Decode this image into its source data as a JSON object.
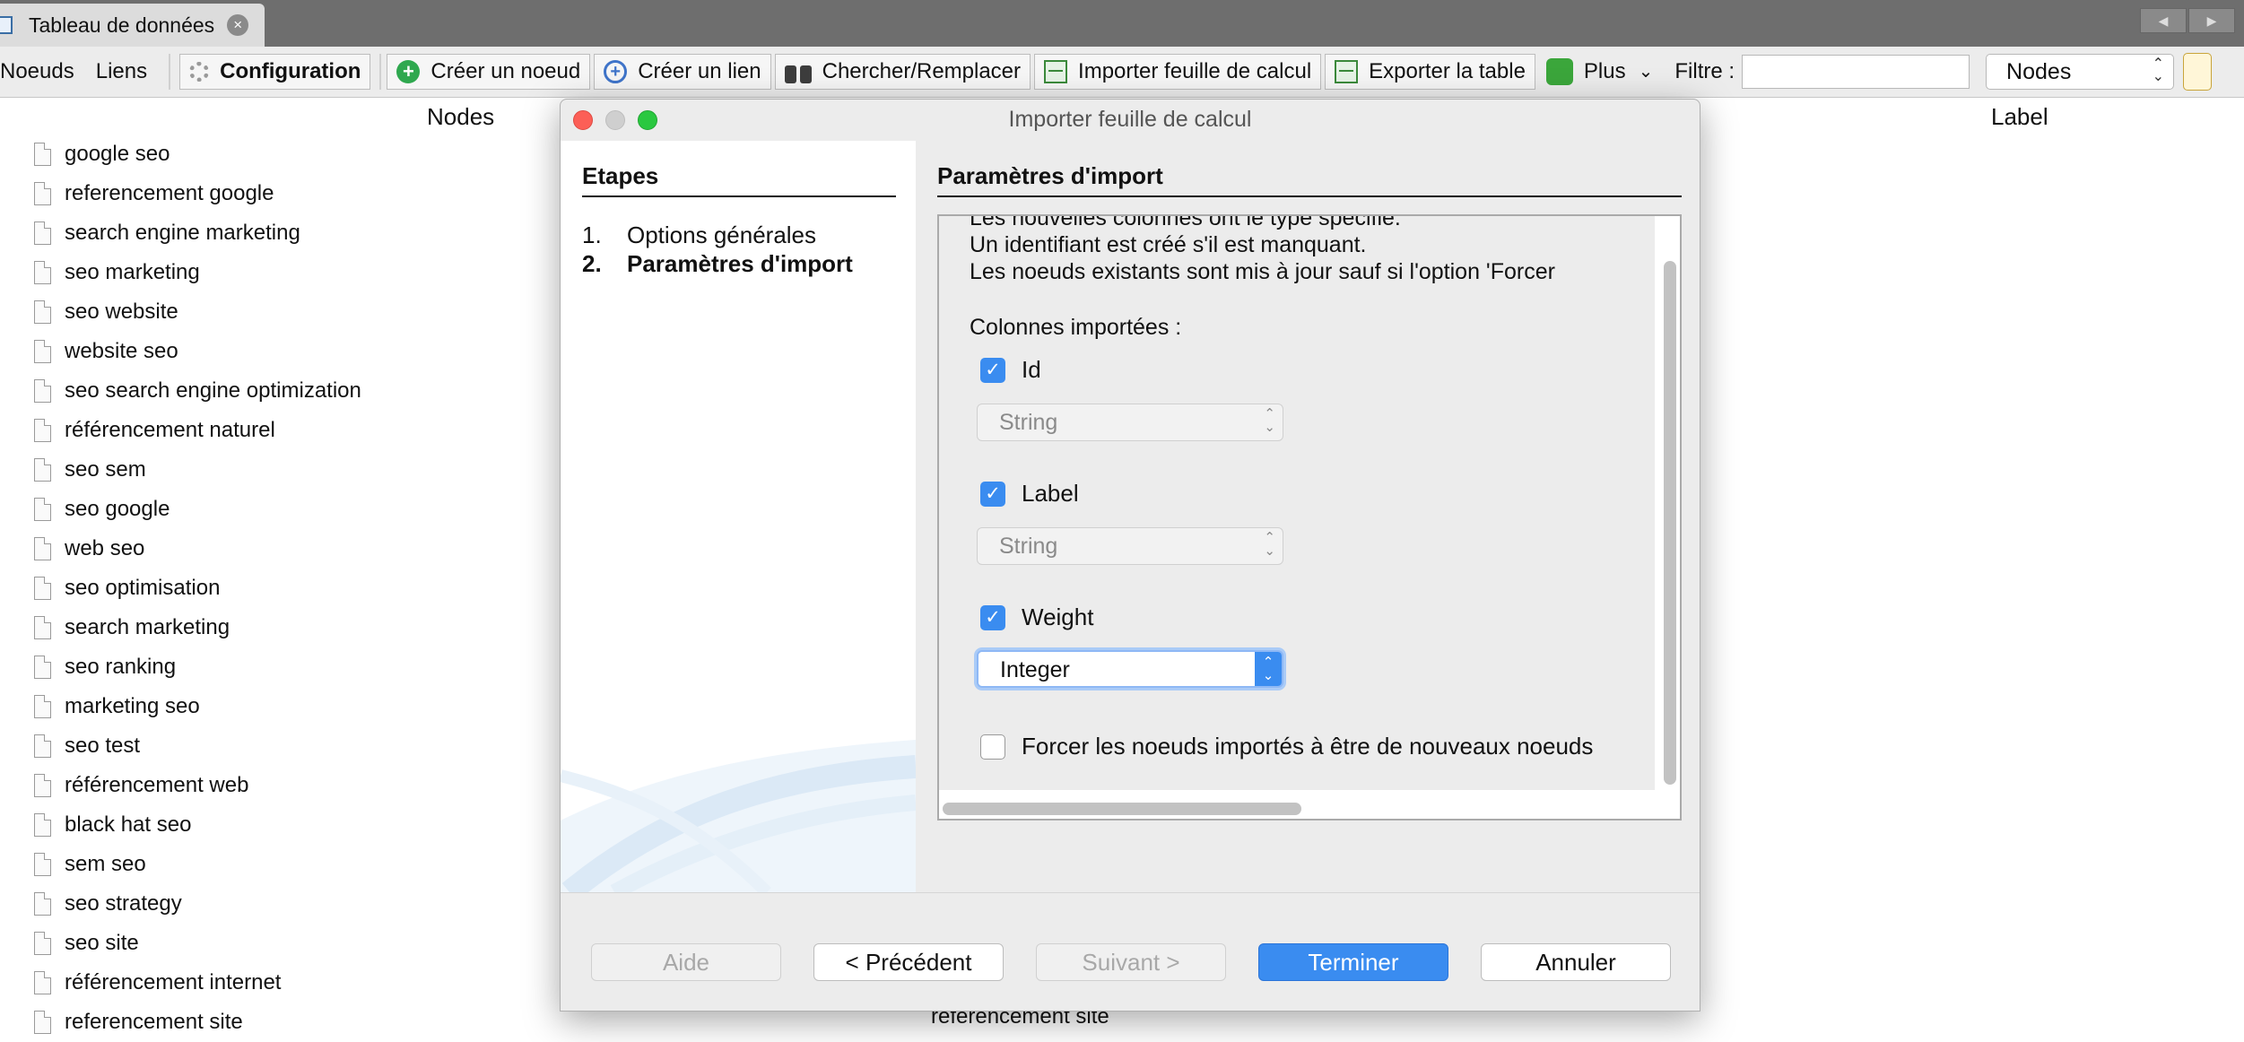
{
  "tab": {
    "title": "Tableau de données",
    "close": "×"
  },
  "nav_arrows": [
    "◀",
    "▶"
  ],
  "toolbar": {
    "nodes": "Noeuds",
    "links": "Liens",
    "configuration": "Configuration",
    "create_node": "Créer un noeud",
    "create_link": "Créer un lien",
    "search_replace": "Chercher/Remplacer",
    "import_sheet": "Importer feuille de calcul",
    "export_table": "Exporter la table",
    "more": "Plus",
    "more_arrow": "⌄",
    "filter_label": "Filtre :",
    "filter_value": "",
    "filter_select": "Nodes"
  },
  "table": {
    "columns": [
      "Nodes",
      "Label"
    ],
    "rows": [
      "google seo",
      "referencement google",
      "search engine marketing",
      "seo marketing",
      "seo website",
      "website seo",
      "seo search engine optimization",
      "référencement naturel",
      "seo sem",
      "seo google",
      "web seo",
      "seo optimisation",
      "search marketing",
      "seo ranking",
      "marketing seo",
      "seo test",
      "référencement web",
      "black hat seo",
      "sem seo",
      "seo strategy",
      "seo site",
      "référencement internet",
      "referencement site"
    ],
    "behind_label": "referencement site"
  },
  "dialog": {
    "title": "Importer feuille de calcul",
    "steps_title": "Etapes",
    "steps": [
      {
        "num": "1.",
        "label": "Options générales"
      },
      {
        "num": "2.",
        "label": "Paramètres d'import"
      }
    ],
    "params_title": "Paramètres d'import",
    "info_lines": [
      "Les nouvelles colonnes ont le type spécifié.",
      "Un identifiant est créé s'il est manquant.",
      "Les noeuds existants sont mis à jour sauf si l'option 'Forcer"
    ],
    "imported_columns_label": "Colonnes importées :",
    "columns": [
      {
        "name": "Id",
        "checked": true,
        "type": "String"
      },
      {
        "name": "Label",
        "checked": true,
        "type": "String"
      },
      {
        "name": "Weight",
        "checked": true,
        "type": "Integer"
      }
    ],
    "force_new_label": "Forcer les noeuds importés à être de nouveaux noeuds",
    "force_new_checked": false,
    "buttons": {
      "help": "Aide",
      "previous": "< Précédent",
      "next": "Suivant >",
      "finish": "Terminer",
      "cancel": "Annuler"
    }
  },
  "colors": {
    "accent": "#3a8cf0",
    "close_red": "#fc5f57",
    "zoom_green": "#2ac840",
    "tabbar": "#6e6e6e"
  }
}
